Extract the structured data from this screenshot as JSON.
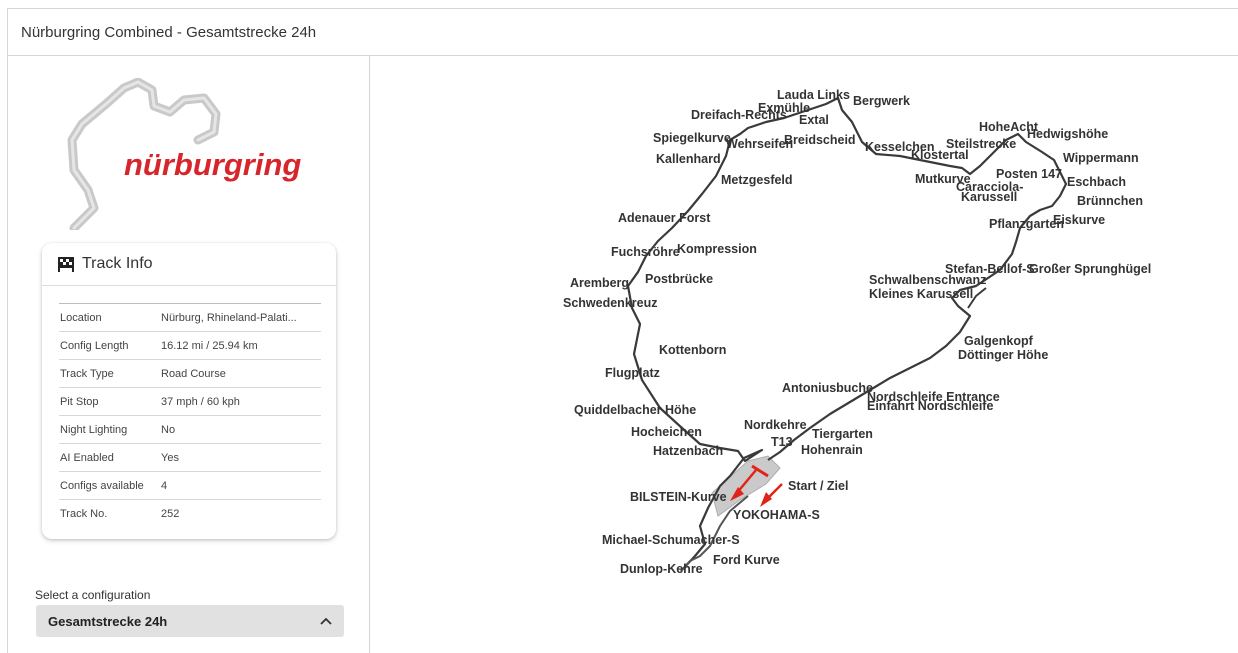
{
  "window": {
    "title": "Nürburgring Combined - Gesamtstrecke 24h"
  },
  "logo": {
    "text": "nürburgring",
    "brand_color": "#d7262b"
  },
  "track_info": {
    "heading": "Track Info",
    "icon": "flag-icon",
    "rows": [
      {
        "label": "Location",
        "value": "Nürburg, Rhineland-Palati..."
      },
      {
        "label": "Config Length",
        "value": "16.12 mi / 25.94 km"
      },
      {
        "label": "Track Type",
        "value": "Road Course"
      },
      {
        "label": "Pit Stop",
        "value": "37 mph / 60 kph"
      },
      {
        "label": "Night Lighting",
        "value": "No"
      },
      {
        "label": "AI Enabled",
        "value": "Yes"
      },
      {
        "label": "Configs available",
        "value": "4"
      },
      {
        "label": "Track No.",
        "value": "252"
      }
    ]
  },
  "config_select": {
    "label": "Select a configuration",
    "value": "Gesamtstrecke 24h",
    "icon": "chevron-up-icon"
  },
  "map": {
    "accent": "#e2231a",
    "labels": {
      "lauda_links": "Lauda Links",
      "bergwerk": "Bergwerk",
      "exmuhle": "Exmühle",
      "dreifach_rechts": "Dreifach-Rechts",
      "extal": "Extal",
      "spiegelkurve": "Spiegelkurve",
      "wehrseifen": "Wehrseifen",
      "breidscheid": "Breidscheid",
      "kallenhard": "Kallenhard",
      "metzgesfeld": "Metzgesfeld",
      "kesselchen": "Kesselchen",
      "klostertal": "Klostertal",
      "hohe_acht": "HoheAcht",
      "steilstrecke": "Steilstrecke",
      "hedwigshohe": "Hedwigshöhe",
      "wippermann": "Wippermann",
      "mutkurve": "Mutkurve",
      "posten_147": "Posten 147",
      "caracciola": "Caracciola-",
      "karussell": "Karussell",
      "eschbach": "Eschbach",
      "brunnchen": "Brünnchen",
      "pflanzgarten": "Pflanzgarten",
      "eiskurve": "Eiskurve",
      "adenauer_forst": "Adenauer Forst",
      "fuchsrohre": "Fuchsröhre",
      "kompression": "Kompression",
      "aremberg": "Aremberg",
      "postbrucke": "Postbrücke",
      "schwedenkreuz": "Schwedenkreuz",
      "stefan_bellof": "Stefan-Bellof-S",
      "grosser_sprunghugel": "Großer Sprunghügel",
      "schwalbenschwanz": "Schwalbenschwanz",
      "kleines_karussell": "Kleines Karussell",
      "kottenborn": "Kottenborn",
      "galgenkopf": "Galgenkopf",
      "dottinger_hohe": "Döttinger Höhe",
      "flugplatz": "Flugplatz",
      "antoniusbuche": "Antoniusbuche",
      "nordschleife_entrance": "Nordschleife Entrance",
      "einfahrt_nordschleife": "Einfahrt Nordschleife",
      "quiddelbacher_hohe": "Quiddelbacher Höhe",
      "nordkehre": "Nordkehre",
      "hocheichen": "Hocheichen",
      "tiergarten": "Tiergarten",
      "t13": "T13",
      "hohenrain": "Hohenrain",
      "hatzenbach": "Hatzenbach",
      "start_ziel": "Start / Ziel",
      "bilstein_kurve": "BILSTEIN-Kurve",
      "yokohama_s": "YOKOHAMA-S",
      "michael_schumacher_s": "Michael-Schumacher-S",
      "ford_kurve": "Ford Kurve",
      "dunlop_kehre": "Dunlop-Kehre"
    }
  }
}
